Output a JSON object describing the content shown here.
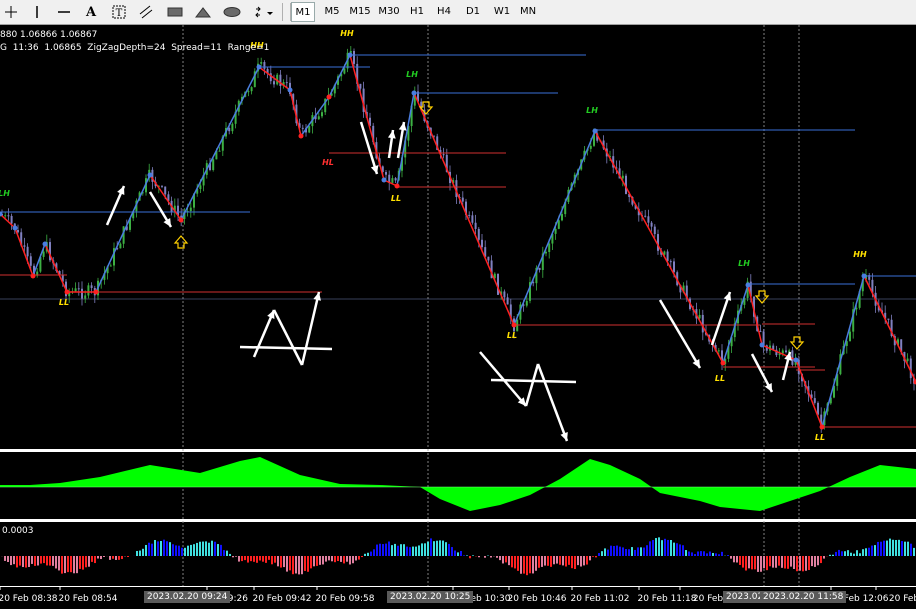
{
  "toolbar": {
    "tools": [
      {
        "name": "cursor-icon",
        "glyph": "cursor"
      },
      {
        "name": "crosshair-icon",
        "glyph": "cross"
      },
      {
        "name": "vertical-line-icon",
        "glyph": "vline"
      },
      {
        "name": "horizontal-line-icon",
        "glyph": "hline"
      },
      {
        "name": "trendline-icon",
        "glyph": "trend"
      },
      {
        "name": "channel-icon",
        "glyph": "channel"
      },
      {
        "name": "text-icon",
        "glyph": "A"
      },
      {
        "name": "text-label-icon",
        "glyph": "T"
      },
      {
        "name": "rectangle-icon",
        "glyph": "rect"
      },
      {
        "name": "triangle-icon",
        "glyph": "tri"
      },
      {
        "name": "ellipse-icon",
        "glyph": "ellipse"
      },
      {
        "name": "arrows-icon",
        "glyph": "arrows"
      }
    ],
    "timeframes": [
      "M1",
      "M5",
      "M15",
      "M30",
      "H1",
      "H4",
      "D1",
      "W1",
      "MN"
    ],
    "active_timeframe": "M1"
  },
  "header": {
    "line1": "880 1.06866 1.06867",
    "line2": "G  11:36  1.06865  ZigZagDepth=24  Spread=11  Range=1"
  },
  "subwindow": {
    "macd_value": "0.0003"
  },
  "time_axis": {
    "labels": [
      "20 Feb 08:38",
      "20 Feb 08:54",
      "09:26",
      "20 Feb 09:42",
      "20 Feb 09:58",
      "20 Feb 10:30",
      "20 Feb 10:46",
      "20 Feb 11:02",
      "20 Feb 11:18",
      "20 Feb",
      "20 Feb 12:06",
      "20 Feb"
    ],
    "crosshair_tags": [
      "2023.02.20 09:24",
      "2023.02.20 10:25",
      "2023.02",
      "2023.02.20 11:58"
    ]
  },
  "zigzag_labels": [
    "LH",
    "LL",
    "HH",
    "HH",
    "HL",
    "LH",
    "LL",
    "LH",
    "LL",
    "LH",
    "LL",
    "HH",
    "LL"
  ],
  "colors": {
    "background": "#000000",
    "bull_candle": "#3cb043",
    "bear_candle": "#8080c0",
    "zigzag_up": "#4a7de0",
    "zigzag_down": "#ff2020",
    "level_blue": "#3a6fd8",
    "level_red": "#d03030",
    "label_yellow": "#ffe000",
    "label_green": "#22cc22",
    "oscillator": "#00ff00",
    "hist_blue": "#1010ff",
    "hist_cyan": "#40e0e0",
    "hist_red": "#ff2020",
    "hist_pink": "#e080a0"
  }
}
